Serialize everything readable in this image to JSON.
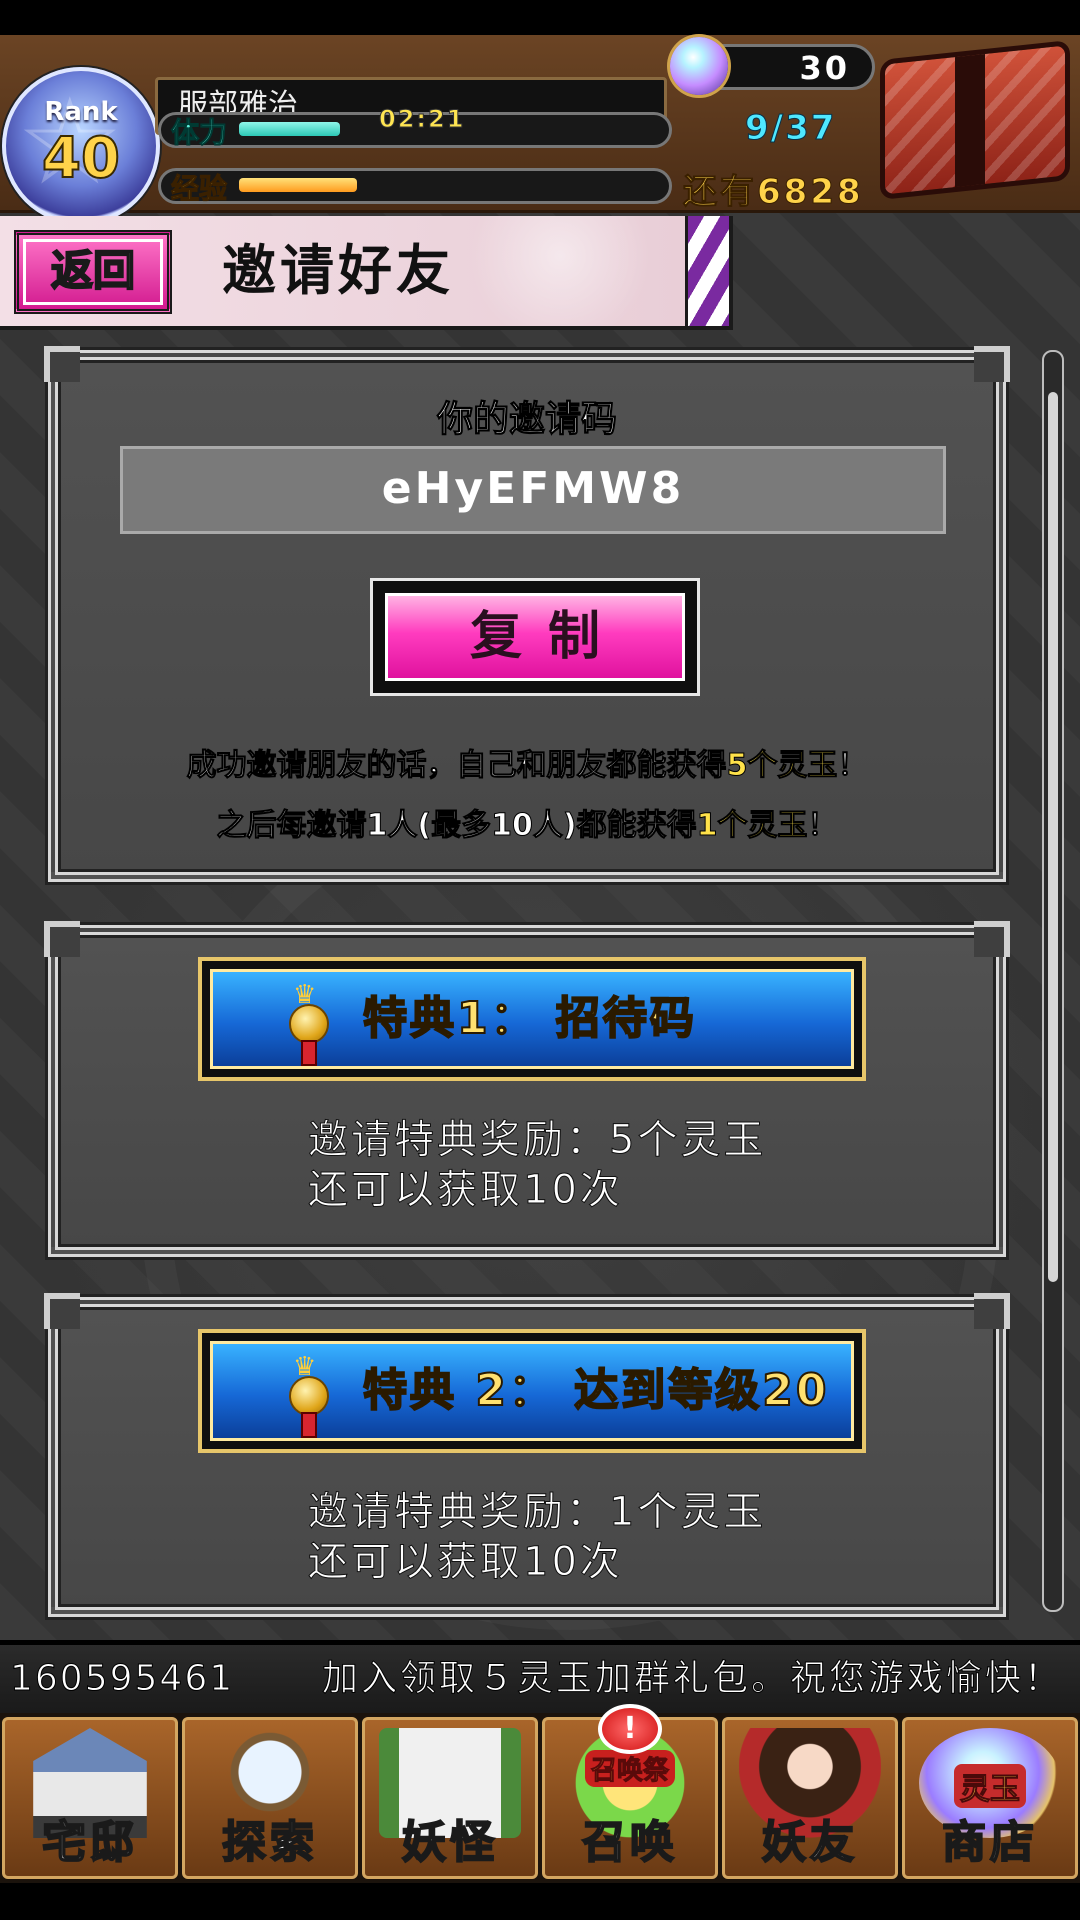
{
  "header": {
    "player_name": "服部雅治",
    "rank_label": "Rank",
    "rank_value": "40",
    "stamina_label": "体力",
    "stamina_timer": "02:21",
    "stamina_count": "9/37",
    "stamina_fill": 0.24,
    "exp_label": "经验",
    "exp_remaining": "还有6828",
    "exp_fill": 0.28,
    "gem_count": "30"
  },
  "title_bar": {
    "back_label": "返回",
    "title": "邀请好友"
  },
  "invite": {
    "heading": "你的邀请码",
    "code": "eHyEFMW8",
    "copy_label": "复制",
    "desc1_pre": "成功邀请朋友的话，自己和朋友都能获得",
    "desc1_hl": "5个灵玉",
    "desc1_post": "！",
    "desc2_pre": "之后每邀请1人(最多10人)都能获得",
    "desc2_hl": "1个灵玉",
    "desc2_post": "！"
  },
  "perks": [
    {
      "title": "特典1：  招待码",
      "reward": "邀请特典奖励：5个灵玉",
      "remaining": "还可以获取10次"
    },
    {
      "title": "特典 2：  达到等级20",
      "reward": "邀请特典奖励：1个灵玉",
      "remaining": "还可以获取10次"
    }
  ],
  "ticker": {
    "id": "160595461",
    "message": "加入领取５灵玉加群礼包。祝您游戏愉快！"
  },
  "nav": {
    "items": [
      {
        "label": "宅邸",
        "icon": "mansion-icon"
      },
      {
        "label": "探索",
        "icon": "magnifier-map-icon"
      },
      {
        "label": "妖怪",
        "icon": "scroll-icon"
      },
      {
        "label": "召唤",
        "icon": "summon-star-icon",
        "badge": "召唤祭",
        "alert": "!"
      },
      {
        "label": "妖友",
        "icon": "fox-girl-icon"
      },
      {
        "label": "商店",
        "icon": "gem-orb-icon",
        "badge": "灵玉"
      }
    ]
  },
  "colors": {
    "accent_pink": "#e0129e",
    "accent_blue": "#1668d6",
    "highlight_yellow": "#ffe24a",
    "panel_gray": "#4d4d4d"
  }
}
